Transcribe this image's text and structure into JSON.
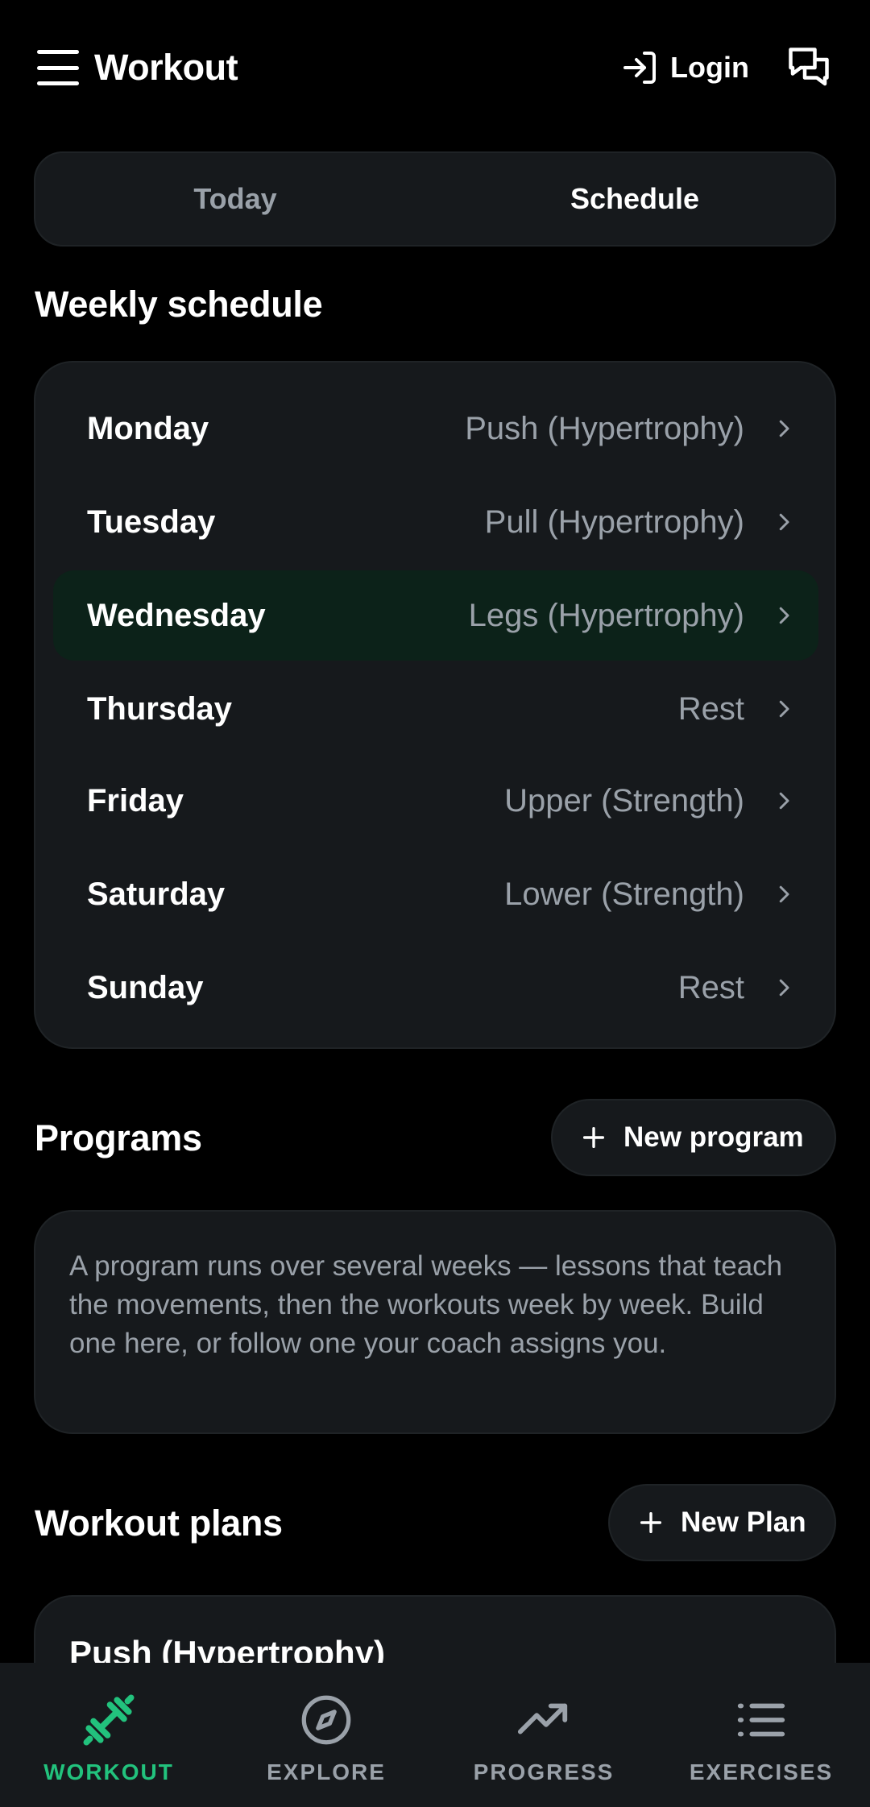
{
  "header": {
    "title": "Workout",
    "login_label": "Login"
  },
  "tabs": [
    {
      "label": "Today",
      "active": false
    },
    {
      "label": "Schedule",
      "active": true
    }
  ],
  "weekly_schedule": {
    "title": "Weekly schedule",
    "days": [
      {
        "day": "Monday",
        "plan": "Push (Hypertrophy)"
      },
      {
        "day": "Tuesday",
        "plan": "Pull (Hypertrophy)"
      },
      {
        "day": "Wednesday",
        "plan": "Legs (Hypertrophy)",
        "highlighted": true
      },
      {
        "day": "Thursday",
        "plan": "Rest"
      },
      {
        "day": "Friday",
        "plan": "Upper (Strength)"
      },
      {
        "day": "Saturday",
        "plan": "Lower (Strength)"
      },
      {
        "day": "Sunday",
        "plan": "Rest"
      }
    ]
  },
  "programs": {
    "title": "Programs",
    "new_button": "New program",
    "description": "A program runs over several weeks — lessons that teach the movements, then the workouts week by week. Build one here, or follow one your coach assigns you."
  },
  "workout_plans": {
    "title": "Workout plans",
    "new_button": "New Plan",
    "items": [
      {
        "name": "Push (Hypertrophy)"
      }
    ]
  },
  "bottom_nav": [
    {
      "label": "WORKOUT",
      "icon": "dumbbell-icon",
      "active": true
    },
    {
      "label": "EXPLORE",
      "icon": "compass-icon",
      "active": false
    },
    {
      "label": "PROGRESS",
      "icon": "trending-up-icon",
      "active": false
    },
    {
      "label": "EXERCISES",
      "icon": "list-icon",
      "active": false
    }
  ],
  "colors": {
    "background": "#000000",
    "card": "#16191c",
    "accent": "#22c27d",
    "highlight_row": "#0c2219",
    "muted_text": "#9aa1a9"
  }
}
